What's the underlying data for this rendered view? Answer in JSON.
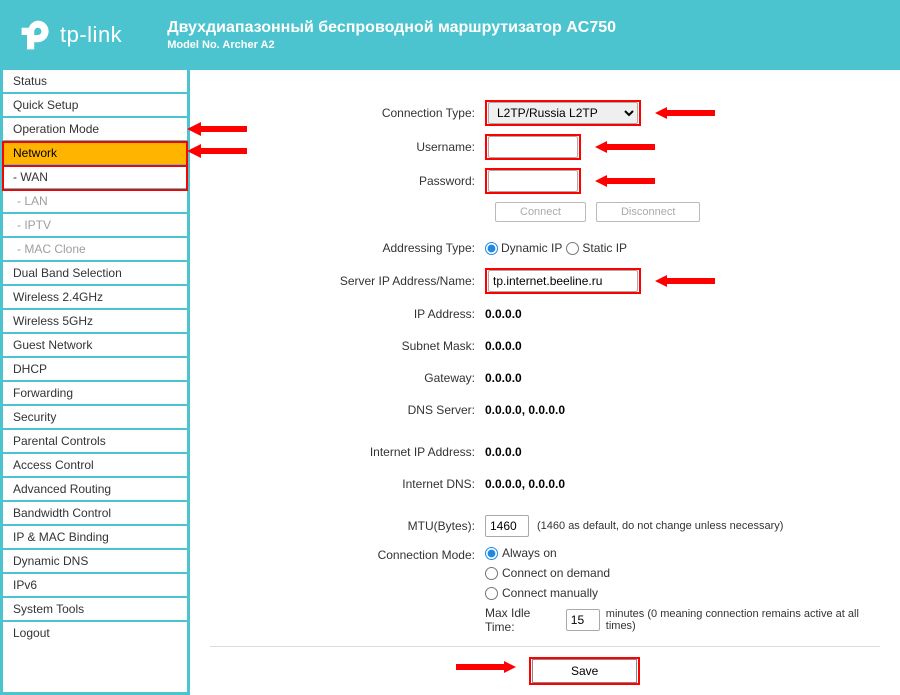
{
  "header": {
    "brand": "tp-link",
    "title": "Двухдиапазонный беспроводной маршрутизатор AC750",
    "model": "Model No. Archer A2"
  },
  "sidebar": {
    "items": [
      {
        "label": "Status"
      },
      {
        "label": "Quick Setup"
      },
      {
        "label": "Operation Mode"
      },
      {
        "label": "Network"
      },
      {
        "label": "- WAN"
      },
      {
        "label": "- LAN"
      },
      {
        "label": "- IPTV"
      },
      {
        "label": "- MAC Clone"
      },
      {
        "label": "Dual Band Selection"
      },
      {
        "label": "Wireless 2.4GHz"
      },
      {
        "label": "Wireless 5GHz"
      },
      {
        "label": "Guest Network"
      },
      {
        "label": "DHCP"
      },
      {
        "label": "Forwarding"
      },
      {
        "label": "Security"
      },
      {
        "label": "Parental Controls"
      },
      {
        "label": "Access Control"
      },
      {
        "label": "Advanced Routing"
      },
      {
        "label": "Bandwidth Control"
      },
      {
        "label": "IP & MAC Binding"
      },
      {
        "label": "Dynamic DNS"
      },
      {
        "label": "IPv6"
      },
      {
        "label": "System Tools"
      },
      {
        "label": "Logout"
      }
    ]
  },
  "form": {
    "connection_type_label": "Connection Type:",
    "connection_type_value": "L2TP/Russia L2TP",
    "username_label": "Username:",
    "username_value": "",
    "password_label": "Password:",
    "password_value": "",
    "connect_btn": "Connect",
    "disconnect_btn": "Disconnect",
    "addressing_type_label": "Addressing Type:",
    "addr_dynamic": "Dynamic IP",
    "addr_static": "Static IP",
    "server_label": "Server IP Address/Name:",
    "server_value": "tp.internet.beeline.ru",
    "ip_addr_label": "IP Address:",
    "ip_addr_value": "0.0.0.0",
    "subnet_label": "Subnet Mask:",
    "subnet_value": "0.0.0.0",
    "gateway_label": "Gateway:",
    "gateway_value": "0.0.0.0",
    "dns_label": "DNS Server:",
    "dns_value": "0.0.0.0,   0.0.0.0",
    "inet_ip_label": "Internet IP Address:",
    "inet_ip_value": "0.0.0.0",
    "inet_dns_label": "Internet DNS:",
    "inet_dns_value": "0.0.0.0,   0.0.0.0",
    "mtu_label": "MTU(Bytes):",
    "mtu_value": "1460",
    "mtu_hint": "(1460 as default, do not change unless necessary)",
    "conn_mode_label": "Connection Mode:",
    "conn_always": "Always on",
    "conn_demand": "Connect on demand",
    "conn_manual": "Connect manually",
    "idle_label": "Max Idle Time:",
    "idle_value": "15",
    "idle_hint": "minutes  (0 meaning connection remains active at all times)",
    "save_btn": "Save"
  }
}
